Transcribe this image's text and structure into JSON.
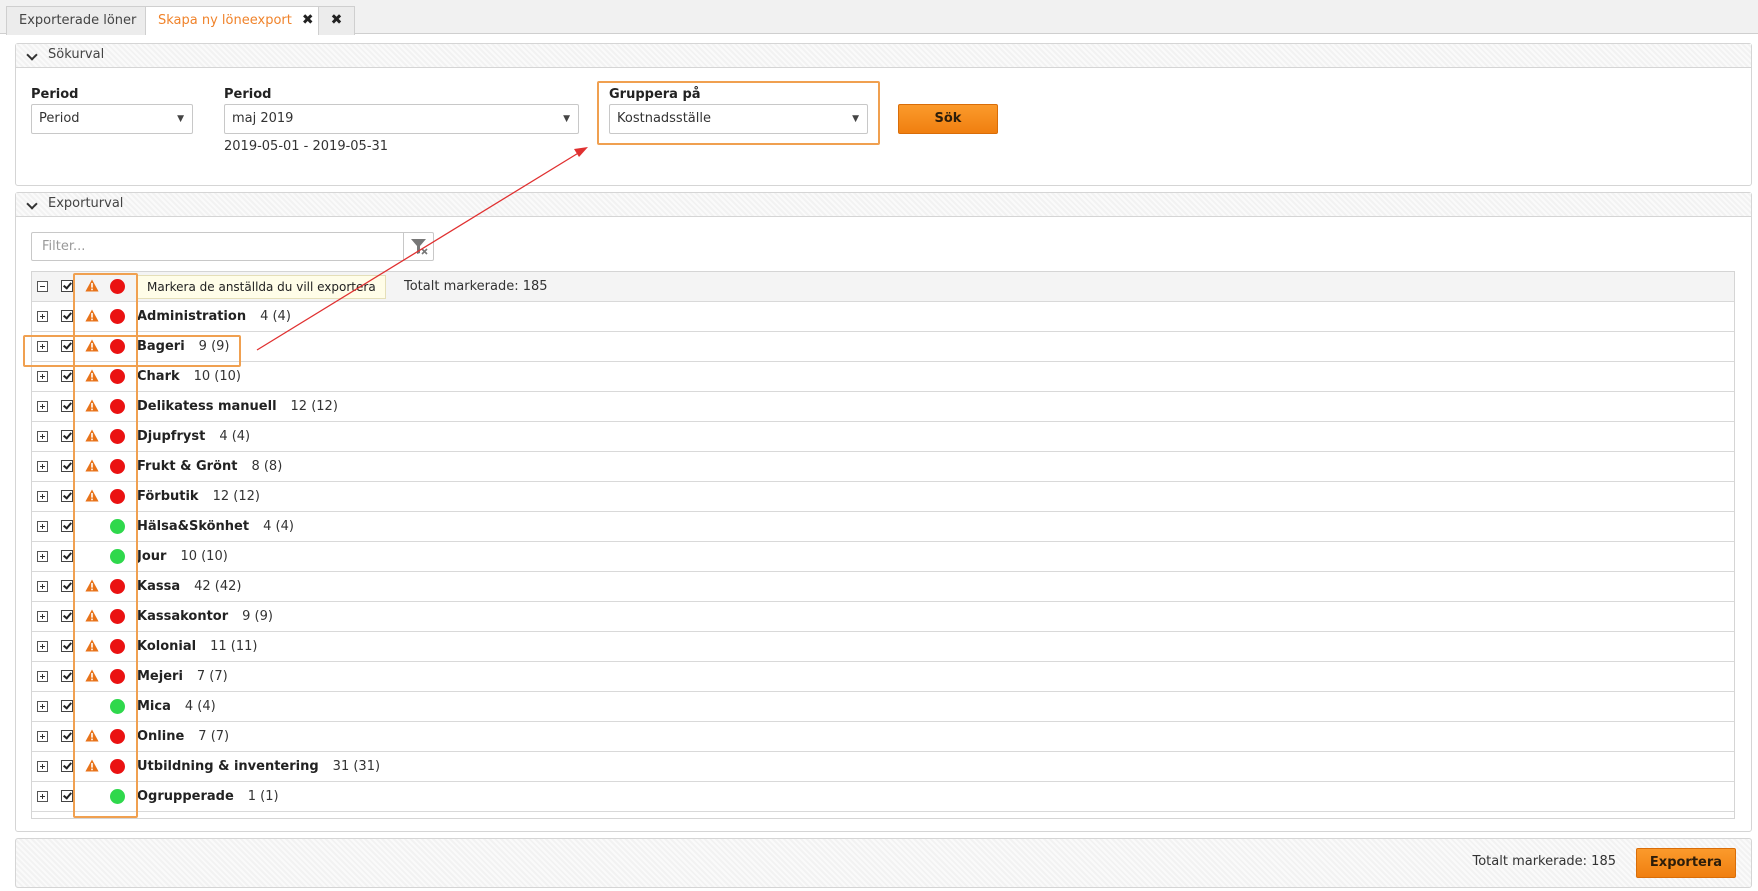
{
  "tabs": [
    {
      "label": "Exporterade löner"
    },
    {
      "label": "Skapa ny löneexport"
    }
  ],
  "search_panel": {
    "title": "Sökurval",
    "period_type": {
      "label": "Period",
      "value": "Period"
    },
    "period": {
      "label": "Period",
      "value": "maj 2019",
      "range": "2019-05-01 - 2019-05-31"
    },
    "group_by": {
      "label": "Gruppera på",
      "value": "Kostnadsställe"
    },
    "search_button": "Sök"
  },
  "export_panel": {
    "title": "Exporturval",
    "filter_placeholder": "Filter...",
    "tooltip": "Markera de anställda du vill exportera",
    "total_selected": "Totalt markerade: 185",
    "groups": [
      {
        "name": "Administration",
        "count": "4 (4)",
        "warning": true,
        "status": "red"
      },
      {
        "name": "Bageri",
        "count": "9 (9)",
        "warning": true,
        "status": "red"
      },
      {
        "name": "Chark",
        "count": "10 (10)",
        "warning": true,
        "status": "red"
      },
      {
        "name": "Delikatess manuell",
        "count": "12 (12)",
        "warning": true,
        "status": "red"
      },
      {
        "name": "Djupfryst",
        "count": "4 (4)",
        "warning": true,
        "status": "red"
      },
      {
        "name": "Frukt & Grönt",
        "count": "8 (8)",
        "warning": true,
        "status": "red"
      },
      {
        "name": "Förbutik",
        "count": "12 (12)",
        "warning": true,
        "status": "red"
      },
      {
        "name": "Hälsa&Skönhet",
        "count": "4 (4)",
        "warning": false,
        "status": "green"
      },
      {
        "name": "Jour",
        "count": "10 (10)",
        "warning": false,
        "status": "green"
      },
      {
        "name": "Kassa",
        "count": "42 (42)",
        "warning": true,
        "status": "red"
      },
      {
        "name": "Kassakontor",
        "count": "9 (9)",
        "warning": true,
        "status": "red"
      },
      {
        "name": "Kolonial",
        "count": "11 (11)",
        "warning": true,
        "status": "red"
      },
      {
        "name": "Mejeri",
        "count": "7 (7)",
        "warning": true,
        "status": "red"
      },
      {
        "name": "Mica",
        "count": "4 (4)",
        "warning": false,
        "status": "green"
      },
      {
        "name": "Online",
        "count": "7 (7)",
        "warning": true,
        "status": "red"
      },
      {
        "name": "Utbildning & inventering",
        "count": "31 (31)",
        "warning": true,
        "status": "red"
      },
      {
        "name": "Ogrupperade",
        "count": "1 (1)",
        "warning": false,
        "status": "green"
      }
    ]
  },
  "footer": {
    "total_selected": "Totalt markerade: 185",
    "export_button": "Exportera"
  },
  "colors": {
    "accent": "#f0832b",
    "status_red": "#ea1212",
    "status_green": "#2fd84c",
    "warning": "#e8731a"
  }
}
